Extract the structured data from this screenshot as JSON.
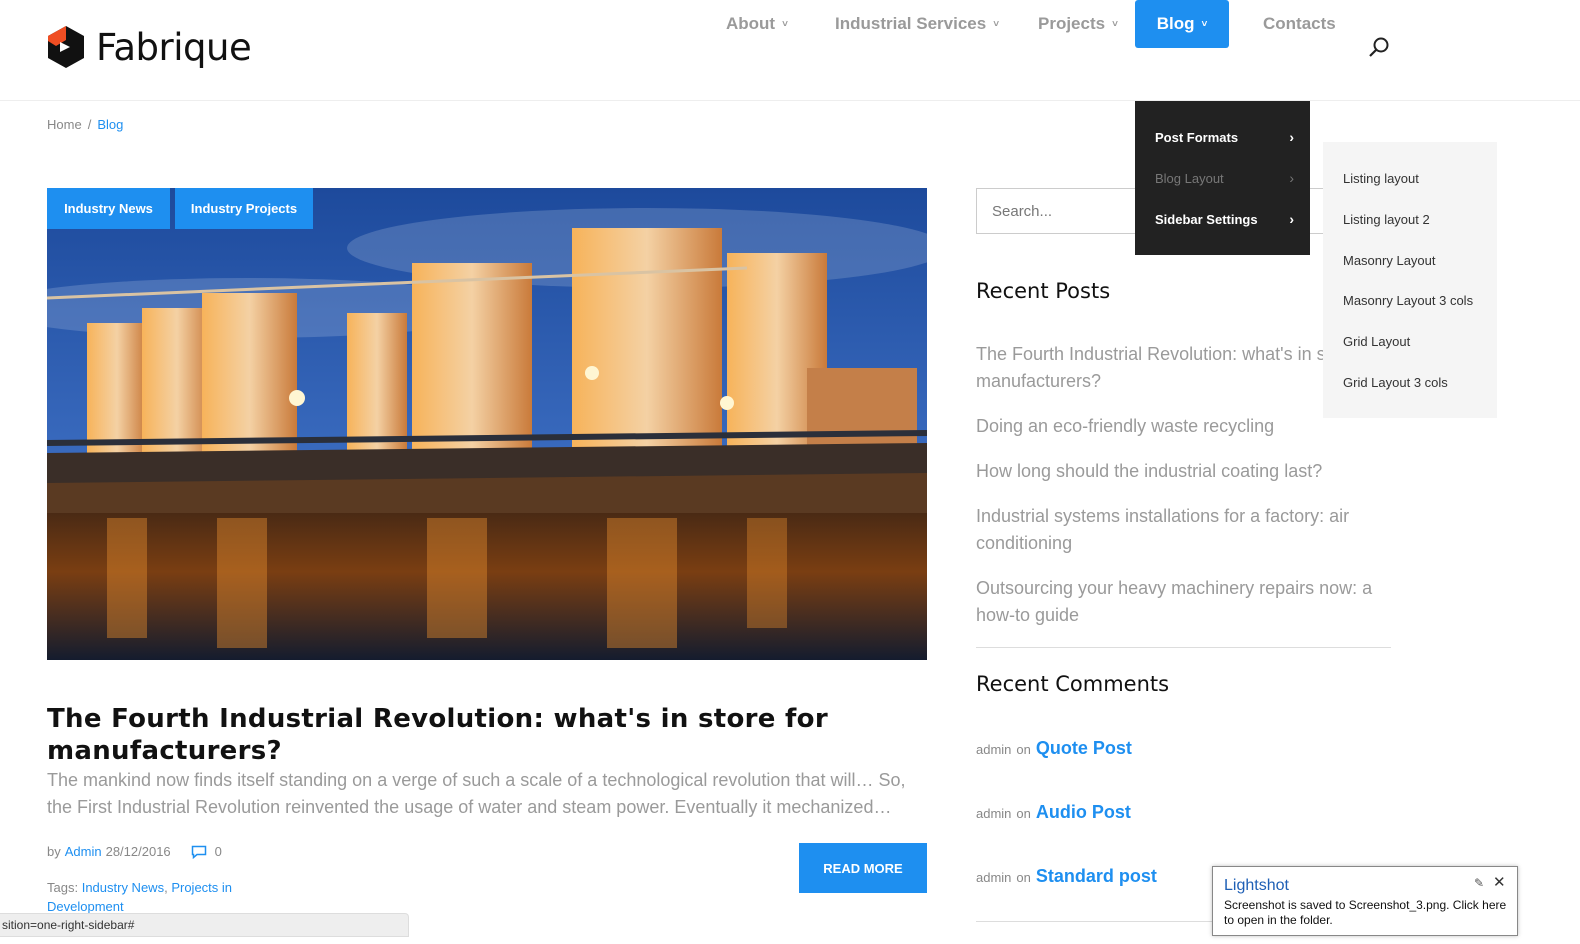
{
  "header": {
    "logo_text": "Fabrique",
    "nav": [
      {
        "label": "About",
        "chevron": "˅"
      },
      {
        "label": "Industrial Services",
        "chevron": "˅"
      },
      {
        "label": "Projects",
        "chevron": "˅"
      },
      {
        "label": "Blog",
        "chevron": "˅"
      },
      {
        "label": "Contacts"
      }
    ]
  },
  "breadcrumb": {
    "home": "Home",
    "separator": "/",
    "current": "Blog"
  },
  "post": {
    "tags_badges": [
      "Industry News",
      "Industry Projects"
    ],
    "title": "The Fourth Industrial Revolution: what's in store for manufacturers?",
    "excerpt": "The mankind now finds itself standing on a verge of such a scale of a technological  revolution that will… So, the First Industrial Revolution reinvented the usage of water and steam power. Eventually it mechanized…",
    "by": "by",
    "author": "Admin",
    "date": "28/12/2016",
    "comments": "0",
    "tags_label": "Tags:",
    "tag_1": "Industry News",
    "tag_comma": ",",
    "tag_2": "Projects in Development",
    "read_more": "READ MORE"
  },
  "sidebar": {
    "search_placeholder": "Search...",
    "recent_posts_title": "Recent Posts",
    "recent_posts": [
      "The Fourth Industrial Revolution: what's in store for manufacturers?",
      "Doing an eco-friendly waste recycling",
      "How long should the industrial coating last?",
      "Industrial systems installations for a factory: air conditioning",
      "Outsourcing your heavy machinery repairs now: a how-to guide"
    ],
    "recent_comments_title": "Recent Comments",
    "comments": [
      {
        "author": "admin",
        "on": "on",
        "post": "Quote Post"
      },
      {
        "author": "admin",
        "on": "on",
        "post": "Audio Post"
      },
      {
        "author": "admin",
        "on": "on",
        "post": "Standard post"
      }
    ]
  },
  "blog_menu": {
    "items": [
      "Post Formats",
      "Blog Layout",
      "Sidebar Settings"
    ],
    "arrow": "›",
    "submenu": [
      "Listing layout",
      "Listing layout 2",
      "Masonry Layout",
      "Masonry Layout 3 cols",
      "Grid Layout",
      "Grid Layout 3 cols"
    ]
  },
  "statusbar": {
    "text": "sition=one-right-sidebar#"
  },
  "toast": {
    "title": "Lightshot",
    "body": "Screenshot is saved to Screenshot_3.png. Click here to open in the folder.",
    "pin": "✎",
    "close": "✕"
  },
  "colors": {
    "accent": "#1e8ff0",
    "dark_menu": "#222222",
    "muted_text": "#9a9a9a"
  },
  "icons": {
    "search": "search-icon",
    "comment": "comment-bubble-icon",
    "logo": "logo-icon"
  }
}
